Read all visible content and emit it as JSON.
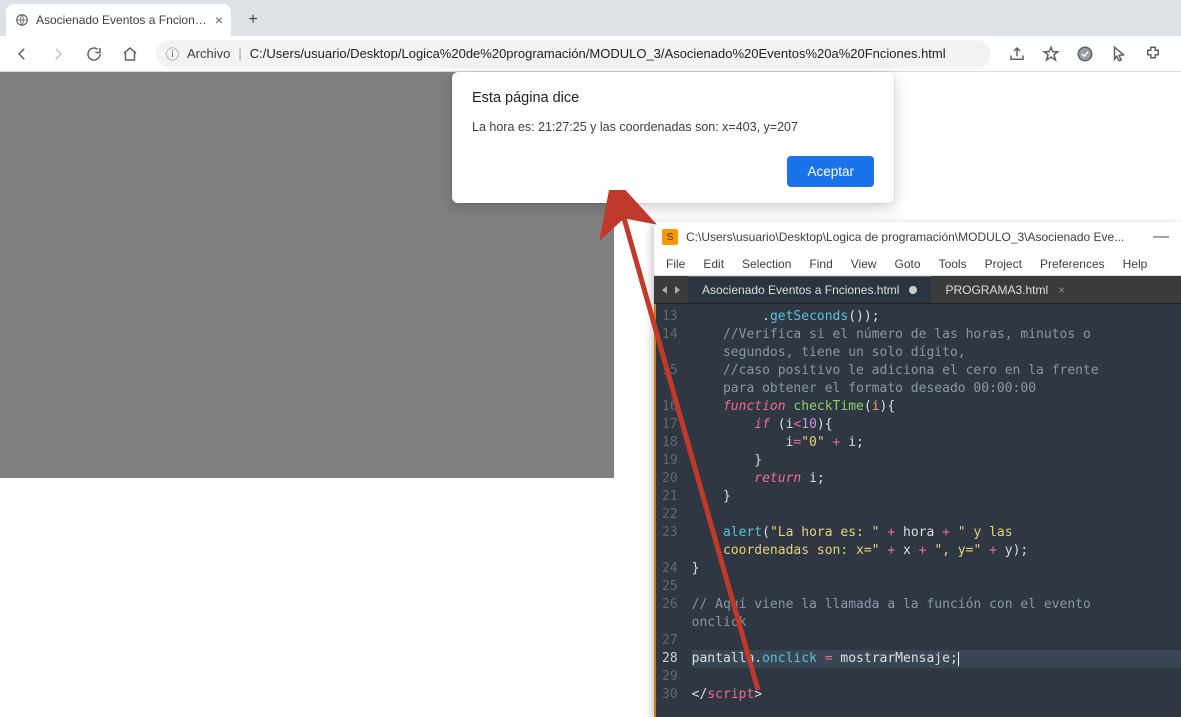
{
  "browser": {
    "tab_title": "Asocienado Eventos a Fnciones.h",
    "addr_label": "Archivo",
    "url": "C:/Users/usuario/Desktop/Logica%20de%20programación/MODULO_3/Asocienado%20Eventos%20a%20Fnciones.html"
  },
  "alert": {
    "title": "Esta página dice",
    "message": "La hora es: 21:27:25 y las coordenadas son: x=403, y=207",
    "accept": "Aceptar"
  },
  "sublime": {
    "title": "C:\\Users\\usuario\\Desktop\\Logica de programación\\MODULO_3\\Asocienado Eve...",
    "menu": [
      "File",
      "Edit",
      "Selection",
      "Find",
      "View",
      "Goto",
      "Tools",
      "Project",
      "Preferences",
      "Help"
    ],
    "tabs": [
      {
        "label": "Asocienado Eventos a Fnciones.html",
        "active": true,
        "dirty": true
      },
      {
        "label": "PROGRAMA3.html",
        "active": false,
        "dirty": false
      }
    ],
    "first_line_no": 13,
    "highlight_line_no": 28
  }
}
